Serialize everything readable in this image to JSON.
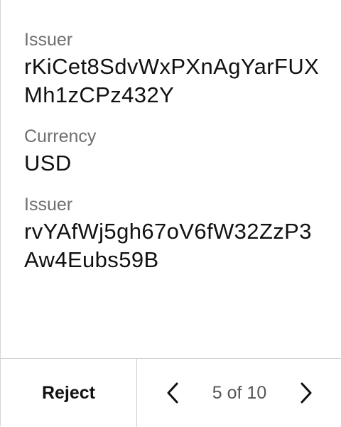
{
  "fields": [
    {
      "label": "Issuer",
      "value": "rKiCet8SdvWxPXnAgYarFUXMh1zCPz432Y"
    },
    {
      "label": "Currency",
      "value": "USD"
    },
    {
      "label": "Issuer",
      "value": "rvYAfWj5gh67oV6fW32ZzP3Aw4Eubs59B"
    }
  ],
  "footer": {
    "reject_label": "Reject",
    "page_indicator": "5 of 10",
    "prev_icon": "chevron-left-icon",
    "next_icon": "chevron-right-icon"
  }
}
